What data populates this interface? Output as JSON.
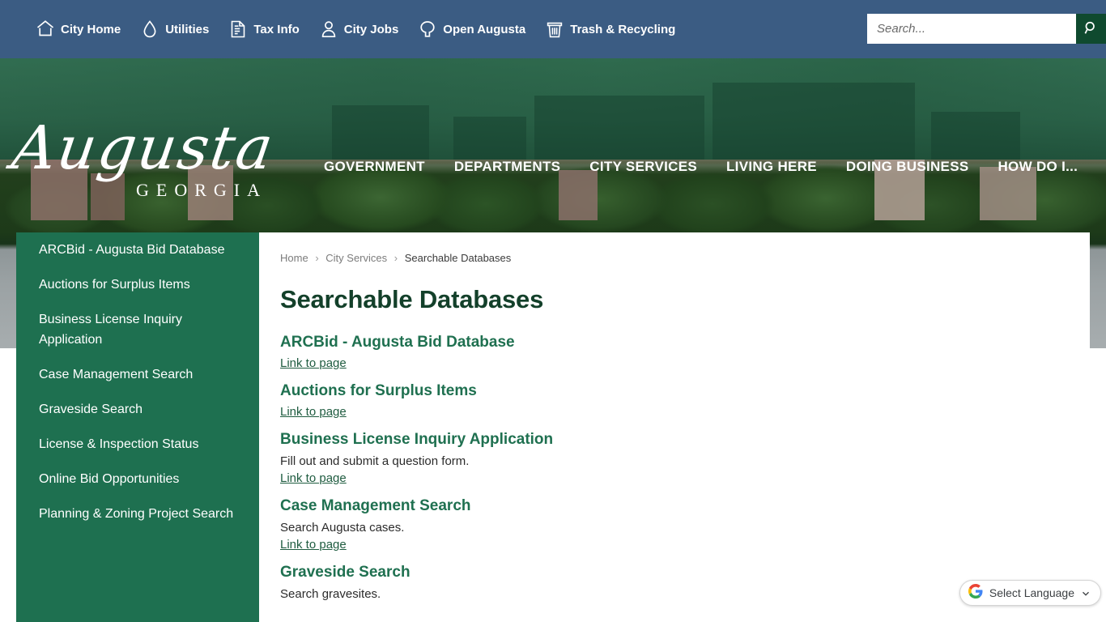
{
  "top_bar": {
    "background_color": "#3b5c83",
    "items": [
      {
        "label": "City Home",
        "icon": "home-icon"
      },
      {
        "label": "Utilities",
        "icon": "water-drop-icon"
      },
      {
        "label": "Tax Info",
        "icon": "document-icon"
      },
      {
        "label": "City Jobs",
        "icon": "person-icon"
      },
      {
        "label": "Open Augusta",
        "icon": "tree-icon"
      },
      {
        "label": "Trash & Recycling",
        "icon": "trash-can-icon"
      }
    ],
    "search": {
      "placeholder": "Search...",
      "value": "",
      "button_icon": "search-icon",
      "button_color": "#0f4a2f"
    }
  },
  "banner": {
    "logo_script": "Augusta",
    "logo_sub": "GEORGIA",
    "green_color": "#2f6b4f",
    "nav": [
      {
        "label": "GOVERNMENT"
      },
      {
        "label": "DEPARTMENTS"
      },
      {
        "label": "CITY SERVICES"
      },
      {
        "label": "LIVING HERE"
      },
      {
        "label": "DOING BUSINESS"
      },
      {
        "label": "HOW DO I..."
      }
    ]
  },
  "sidebar": {
    "background_color": "#1e7050",
    "items": [
      {
        "label": "ARCBid - Augusta Bid Database"
      },
      {
        "label": "Auctions for Surplus Items"
      },
      {
        "label": "Business License Inquiry Application"
      },
      {
        "label": "Case Management Search"
      },
      {
        "label": "Graveside Search"
      },
      {
        "label": "License & Inspection Status"
      },
      {
        "label": "Online Bid Opportunities"
      },
      {
        "label": "Planning & Zoning Project Search"
      }
    ]
  },
  "main": {
    "breadcrumb": {
      "home": "Home",
      "parent": "City Services",
      "current": "Searchable Databases",
      "separator": "›"
    },
    "page_title": "Searchable Databases",
    "accent_color": "#1f7050",
    "blocks": [
      {
        "title": "ARCBid - Augusta Bid Database",
        "description": "",
        "link_text": "Link to page"
      },
      {
        "title": "Auctions for Surplus Items",
        "description": "",
        "link_text": "Link to page"
      },
      {
        "title": "Business License Inquiry Application",
        "description": "Fill out and submit a question form.",
        "link_text": "Link to page"
      },
      {
        "title": "Case Management Search",
        "description": "Search Augusta cases.",
        "link_text": "Link to page"
      },
      {
        "title": "Graveside Search",
        "description": "Search gravesites.",
        "link_text": ""
      }
    ]
  },
  "translate_widget": {
    "label": "Select Language",
    "icon": "google-g-icon",
    "caret": "chevron-down-icon"
  }
}
